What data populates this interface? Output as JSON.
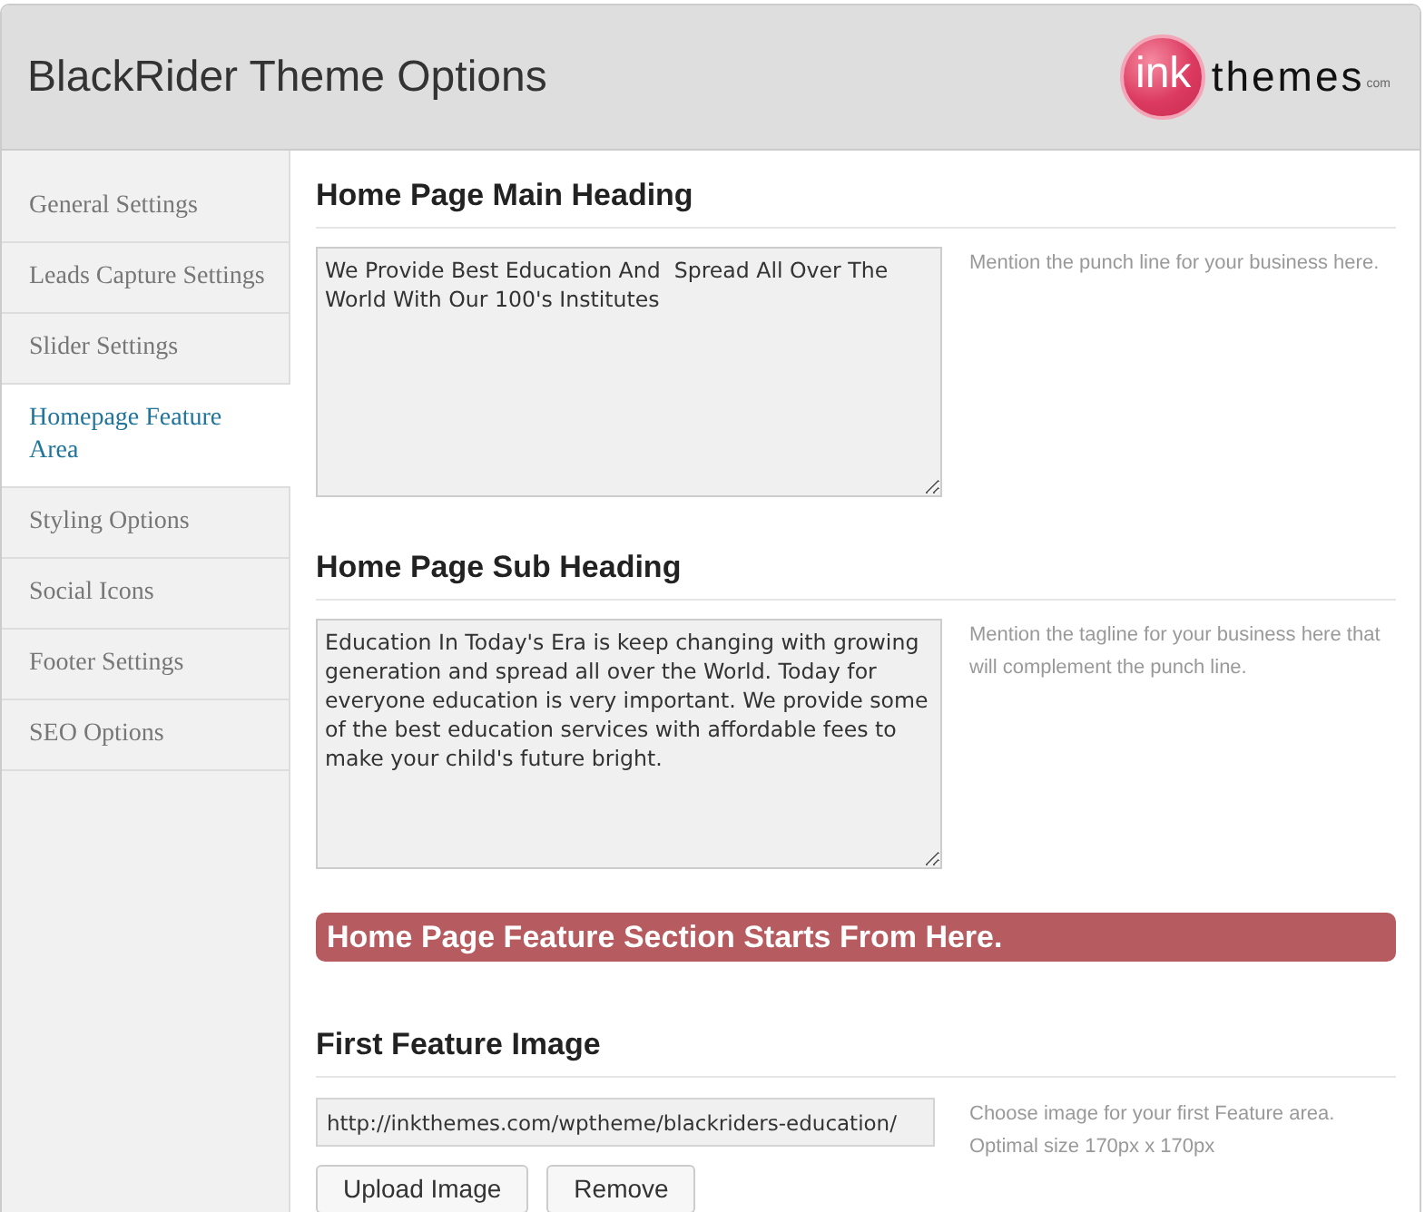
{
  "header": {
    "title": "BlackRider Theme Options",
    "logo": {
      "mark": "ink",
      "wordmark": "themes",
      "suffix": "com"
    }
  },
  "sidebar": {
    "items": [
      {
        "label": "General Settings",
        "selected": false
      },
      {
        "label": "Leads Capture Settings",
        "selected": false
      },
      {
        "label": "Slider Settings",
        "selected": false
      },
      {
        "label": "Homepage Feature Area",
        "selected": true
      },
      {
        "label": "Styling Options",
        "selected": false
      },
      {
        "label": "Social Icons",
        "selected": false
      },
      {
        "label": "Footer Settings",
        "selected": false
      },
      {
        "label": "SEO Options",
        "selected": false
      }
    ]
  },
  "content": {
    "sections": [
      {
        "kind": "textarea",
        "heading": "Home Page Main Heading",
        "value": "We Provide Best Education And  Spread All Over The World With Our 100's Institutes",
        "hint": [
          "Mention the punch line for your business here."
        ]
      },
      {
        "kind": "textarea",
        "heading": "Home Page Sub Heading",
        "value": "Education In Today's Era is keep changing with growing generation and spread all over the World. Today for everyone education is very important. We provide some of the best education services with affordable fees to make your child's future bright.",
        "hint": [
          "Mention the tagline for your business here that",
          "will complement the punch line."
        ]
      },
      {
        "kind": "banner",
        "text": "Home Page Feature Section Starts From Here."
      },
      {
        "kind": "upload",
        "heading": "First Feature Image",
        "value": "http://inkthemes.com/wptheme/blackriders-education/",
        "hint": [
          "Choose image for your first Feature area.",
          "Optimal size 170px x 170px"
        ],
        "buttons": [
          "Upload Image",
          "Remove"
        ]
      }
    ]
  }
}
